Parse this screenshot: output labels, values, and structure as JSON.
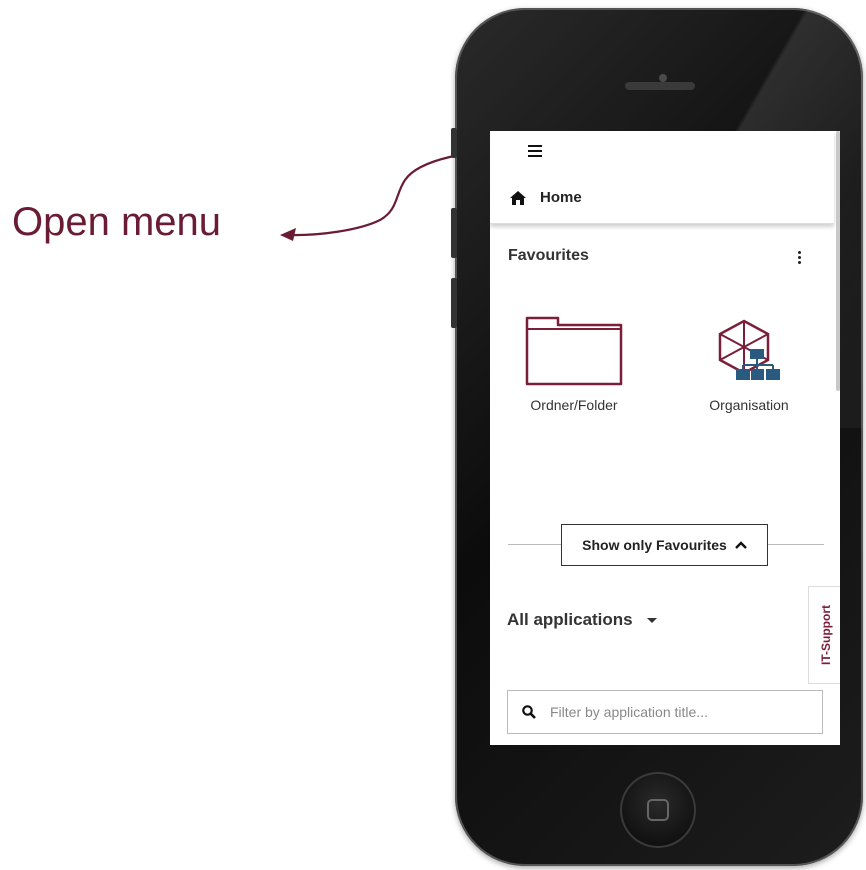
{
  "annotation": {
    "label": "Open menu",
    "color": "#6b1c35"
  },
  "topbar": {
    "menu_icon": "hamburger-icon",
    "home_icon": "home-icon",
    "home_label": "Home"
  },
  "favourites": {
    "title": "Favourites",
    "options_icon": "vertical-ellipsis-icon",
    "tiles": [
      {
        "label": "Ordner/Folder",
        "icon": "folder-icon"
      },
      {
        "label": "Organisation",
        "icon": "org-chart-icon"
      }
    ],
    "toggle_label": "Show only Favourites",
    "toggle_icon": "chevron-up-icon"
  },
  "applications": {
    "title": "All applications",
    "dropdown_icon": "caret-down-icon"
  },
  "it_support": {
    "label": "IT-Support"
  },
  "filter": {
    "placeholder": "Filter by application title...",
    "value": "",
    "icon": "search-icon"
  },
  "colors": {
    "accent": "#7b1e3a",
    "org_blue": "#2a5a7f"
  }
}
